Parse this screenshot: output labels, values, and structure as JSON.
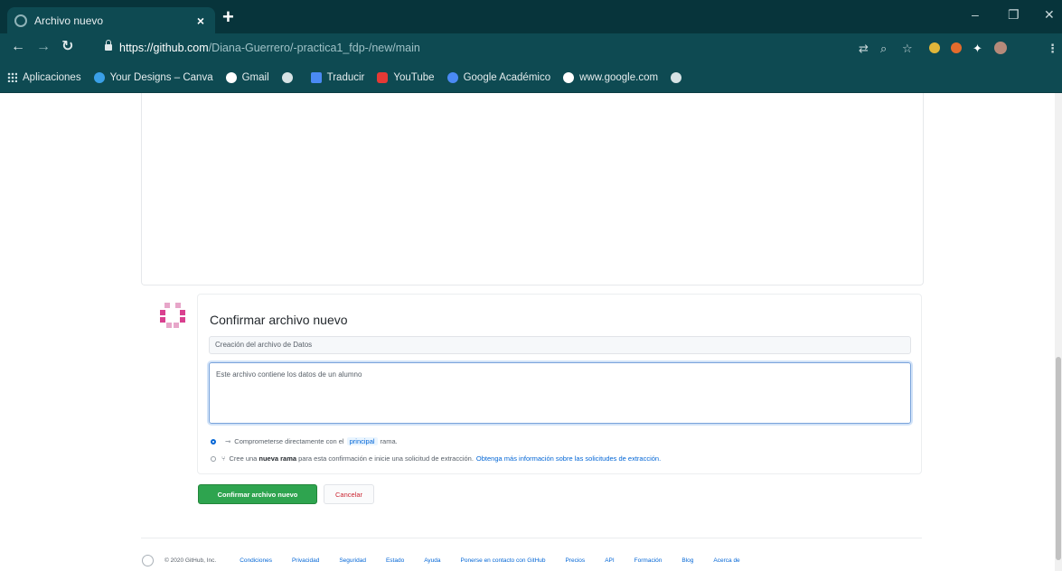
{
  "browser": {
    "tab_title": "Archivo nuevo",
    "tab_close": "×",
    "new_tab": "+",
    "url_prefix": "https://",
    "url_host": "github.com",
    "url_path": "/Diana-Guerrero/-practica1_fdp-/new/main",
    "window_controls": {
      "minimize": "–",
      "maximize": "❐",
      "close": "✕"
    }
  },
  "bookmarks": [
    {
      "label": "Aplicaciones",
      "icon": "apps-grid-icon",
      "color": "#cfe0e3"
    },
    {
      "label": "Your Designs – Canva",
      "icon": "canva-icon",
      "color": "#3aa0e8"
    },
    {
      "label": "Gmail",
      "icon": "google-icon",
      "color": "#ffffff"
    },
    {
      "label": "",
      "icon": "globe-icon",
      "color": "#d7e3e5"
    },
    {
      "label": "Traducir",
      "icon": "translate-icon",
      "color": "#4a8af4"
    },
    {
      "label": "YouTube",
      "icon": "youtube-icon",
      "color": "#e53935"
    },
    {
      "label": "Google Académico",
      "icon": "scholar-icon",
      "color": "#4a8af4"
    },
    {
      "label": "www.google.com",
      "icon": "google-icon",
      "color": "#ffffff"
    },
    {
      "label": "",
      "icon": "globe-icon",
      "color": "#d7e3e5"
    }
  ],
  "commit": {
    "title": "Confirmar archivo nuevo",
    "summary_value": "Creación del archivo de Datos",
    "description_value": "Este archivo contiene los datos de un alumno",
    "option_direct_prefix": "Comprometerse directamente con el",
    "option_direct_branch": "principal",
    "option_direct_suffix": "rama.",
    "option_new_prefix": "Cree una",
    "option_new_bold": "nueva rama",
    "option_new_suffix": "para esta confirmación e inicie una solicitud de extracción.",
    "option_new_link": "Obtenga más información sobre las solicitudes de extracción.",
    "submit_label": "Confirmar archivo nuevo",
    "cancel_label": "Cancelar"
  },
  "footer": {
    "copyright": "© 2020 GitHub, Inc.",
    "links": [
      "Condiciones",
      "Privacidad",
      "Seguridad",
      "Estado",
      "Ayuda",
      "Ponerse en contacto con GitHub",
      "Precios",
      "API",
      "Formación",
      "Blog",
      "Acerca de"
    ]
  },
  "colors": {
    "chrome_dark": "#07343b",
    "chrome": "#0e4a52",
    "primary_button": "#2ea44f",
    "link": "#0366d6",
    "danger": "#cb2431"
  }
}
